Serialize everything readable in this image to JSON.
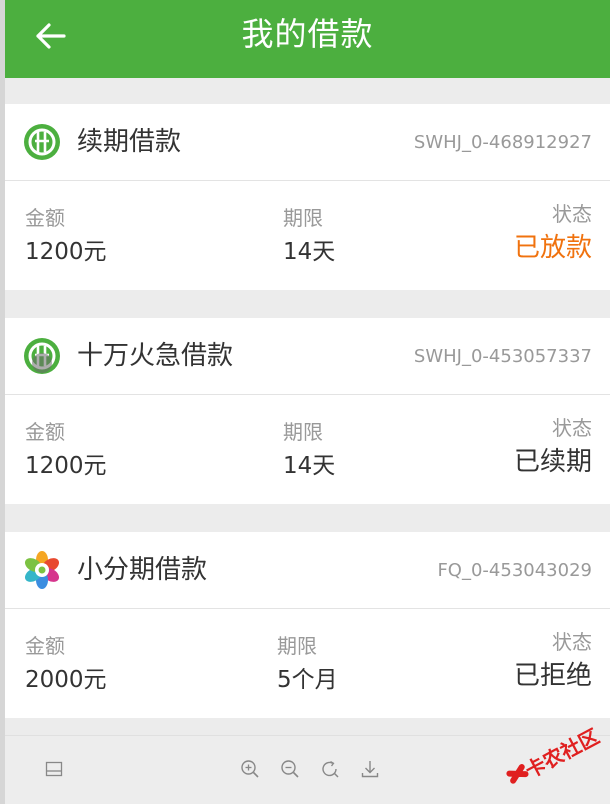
{
  "header": {
    "title": "我的借款",
    "back_icon": "arrow-left-icon"
  },
  "labels": {
    "amount": "金额",
    "term": "期限",
    "status": "状态"
  },
  "loans": [
    {
      "name": "续期借款",
      "id": "SWHJ_0-468912927",
      "amount": "1200元",
      "term": "14天",
      "status": "已放款",
      "status_color": "#f0720e",
      "logo": "green-coin-logo-icon"
    },
    {
      "name": "十万火急借款",
      "id": "SWHJ_0-453057337",
      "amount": "1200元",
      "term": "14天",
      "status": "已续期",
      "status_color": "#333333",
      "logo": "green-coin-logo-icon"
    },
    {
      "name": "小分期借款",
      "id": "FQ_0-453043029",
      "amount": "2000元",
      "term": "5个月",
      "status": "已拒绝",
      "status_color": "#333333",
      "logo": "colorful-flower-logo-icon"
    }
  ],
  "toolbar": {
    "icons": [
      "layout-icon",
      "zoom-in-icon",
      "zoom-out-icon",
      "rotate-icon",
      "download-icon"
    ]
  },
  "watermark": {
    "text": "卡农社区"
  },
  "colors": {
    "header_bg": "#4caf3f",
    "accent_orange": "#f0720e"
  }
}
